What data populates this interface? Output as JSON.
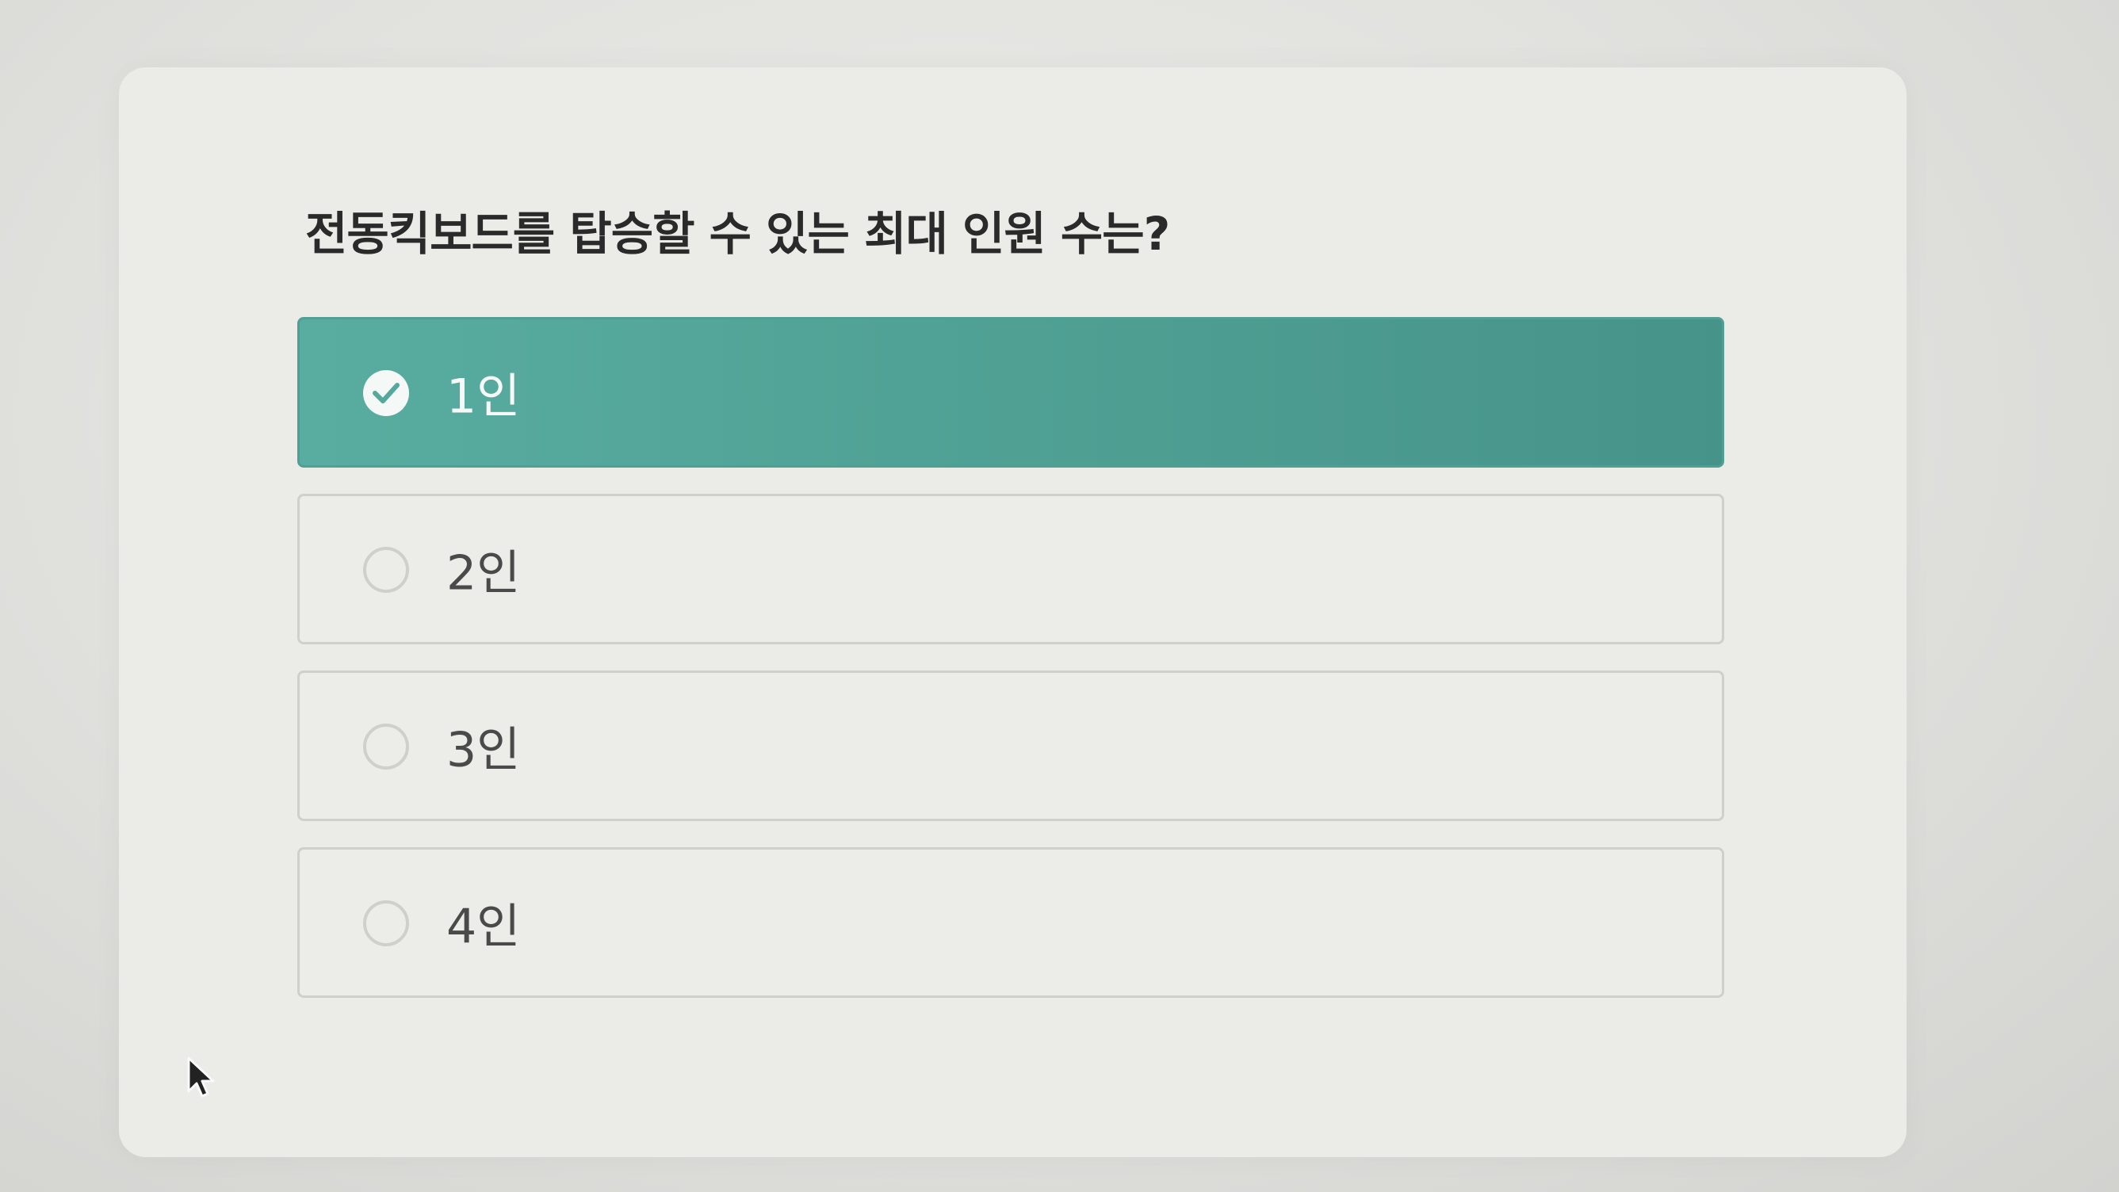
{
  "quiz": {
    "question": "전동킥보드를 탑승할 수 있는 최대 인원 수는?",
    "options": [
      {
        "label": "1인",
        "selected": true
      },
      {
        "label": "2인",
        "selected": false
      },
      {
        "label": "3인",
        "selected": false
      },
      {
        "label": "4인",
        "selected": false
      }
    ]
  },
  "colors": {
    "selected_fill": "#55a99c",
    "card_bg": "#ebebe8",
    "border": "#cfcfcc"
  },
  "icons": {
    "selected": "check-circle-icon",
    "unselected": "radio-empty-icon",
    "pointer": "mouse-cursor-icon"
  }
}
